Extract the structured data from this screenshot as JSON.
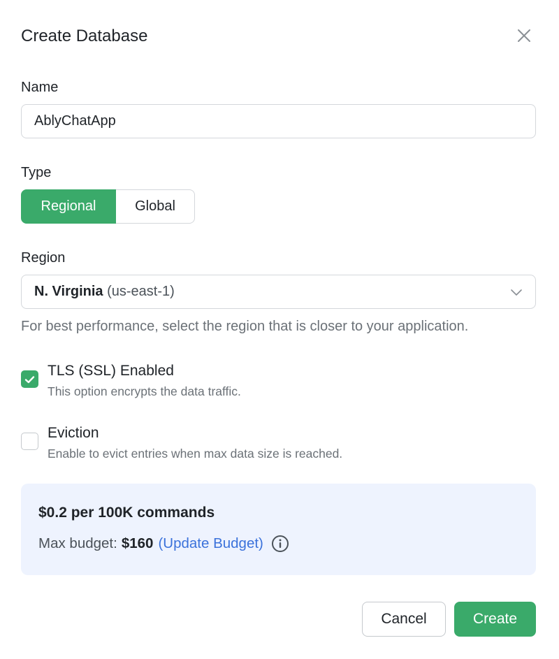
{
  "dialog": {
    "title": "Create Database"
  },
  "name": {
    "label": "Name",
    "value": "AblyChatApp"
  },
  "type": {
    "label": "Type",
    "options": [
      "Regional",
      "Global"
    ],
    "selected": "Regional"
  },
  "region": {
    "label": "Region",
    "selected_name": "N. Virginia",
    "selected_code": "(us-east-1)",
    "helper": "For best performance, select the region that is closer to your application."
  },
  "options": {
    "tls": {
      "title": "TLS (SSL) Enabled",
      "description": "This option encrypts the data traffic.",
      "checked": true
    },
    "eviction": {
      "title": "Eviction",
      "description": "Enable to evict entries when max data size is reached.",
      "checked": false
    }
  },
  "pricing": {
    "price": "$0.2 per 100K commands",
    "budget_label": "Max budget:",
    "budget_value": "$160",
    "update_link": "(Update Budget)"
  },
  "actions": {
    "cancel": "Cancel",
    "create": "Create"
  },
  "icons": {
    "close": "close-icon",
    "chevron": "chevron-down-icon",
    "check": "check-icon",
    "info": "info-icon"
  },
  "colors": {
    "primary_green": "#3aaa6a",
    "link_blue": "#3b72db",
    "pricing_bg": "#eef3fe"
  }
}
